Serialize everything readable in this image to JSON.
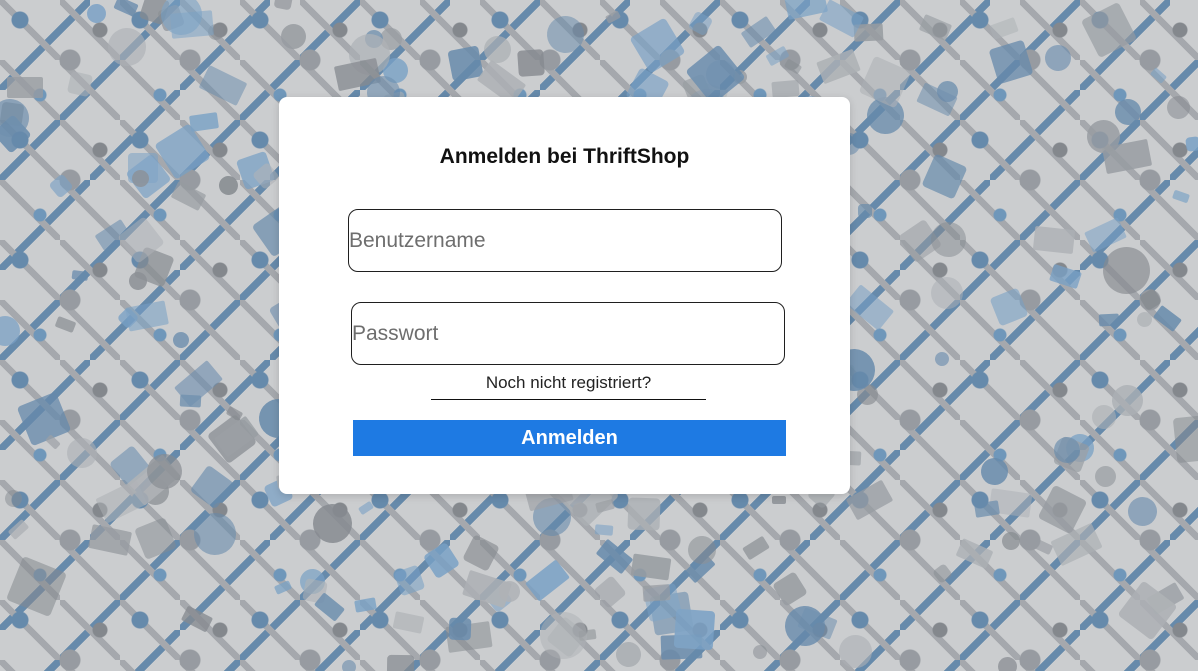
{
  "login": {
    "title": "Anmelden bei ThriftShop",
    "username_placeholder": "Benutzername",
    "username_value": "",
    "password_placeholder": "Passwort",
    "password_value": "",
    "register_link": "Noch nicht registriert?",
    "submit_label": "Anmelden"
  },
  "colors": {
    "button_background": "#1e7ae3",
    "button_text": "#ffffff",
    "card_background": "#ffffff",
    "pattern_blue": "#2f6496",
    "pattern_gray": "#7a7f86"
  },
  "background": {
    "icons": [
      "cloud-icon",
      "airplane-icon",
      "heart-icon",
      "gear-icon",
      "clock-icon",
      "mail-icon",
      "bicycle-icon",
      "guitar-icon",
      "car-icon",
      "camera-icon",
      "chat-icon",
      "lightbulb-icon",
      "person-icon",
      "cassette-icon",
      "ice-cream-icon",
      "sun-icon"
    ]
  }
}
